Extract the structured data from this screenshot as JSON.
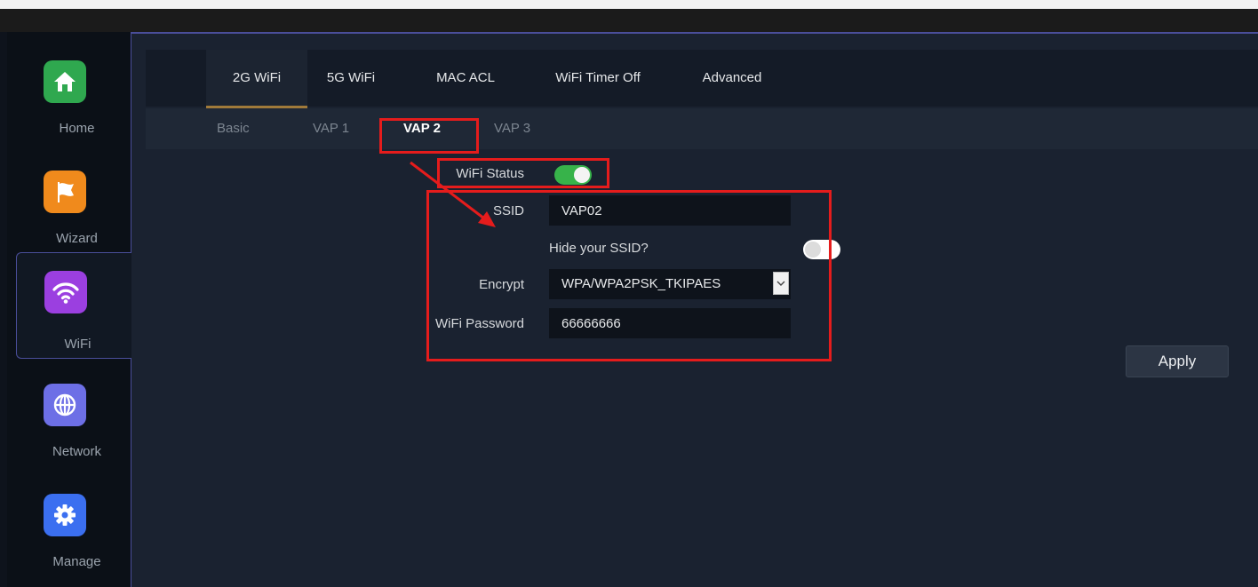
{
  "sidebar": {
    "items": [
      {
        "label": "Home",
        "icon": "home-icon",
        "color": "#2fa84f"
      },
      {
        "label": "Wizard",
        "icon": "flag-icon",
        "color": "#f08a1c"
      },
      {
        "label": "WiFi",
        "icon": "wifi-icon",
        "color": "#9b3fe0"
      },
      {
        "label": "Network",
        "icon": "globe-icon",
        "color": "#6d6fe6"
      },
      {
        "label": "Manage",
        "icon": "gear-icon",
        "color": "#3b6ff0"
      }
    ],
    "active": "WiFi"
  },
  "tabs": [
    "2G WiFi",
    "5G WiFi",
    "MAC ACL",
    "WiFi Timer Off",
    "Advanced"
  ],
  "active_tab": "2G WiFi",
  "subtabs": [
    "Basic",
    "VAP 1",
    "VAP 2",
    "VAP 3"
  ],
  "active_subtab": "VAP 2",
  "form": {
    "wifi_status_label": "WiFi Status",
    "ssid_label": "SSID",
    "ssid_value": "VAP02",
    "hide_ssid_label": "Hide your SSID?",
    "encrypt_label": "Encrypt",
    "encrypt_value": "WPA/WPA2PSK_TKIPAES",
    "password_label": "WiFi Password",
    "password_value": "66666666"
  },
  "apply_label": "Apply",
  "colors": {
    "annotation": "#e51c1c",
    "toggle_on": "#37b34a"
  }
}
